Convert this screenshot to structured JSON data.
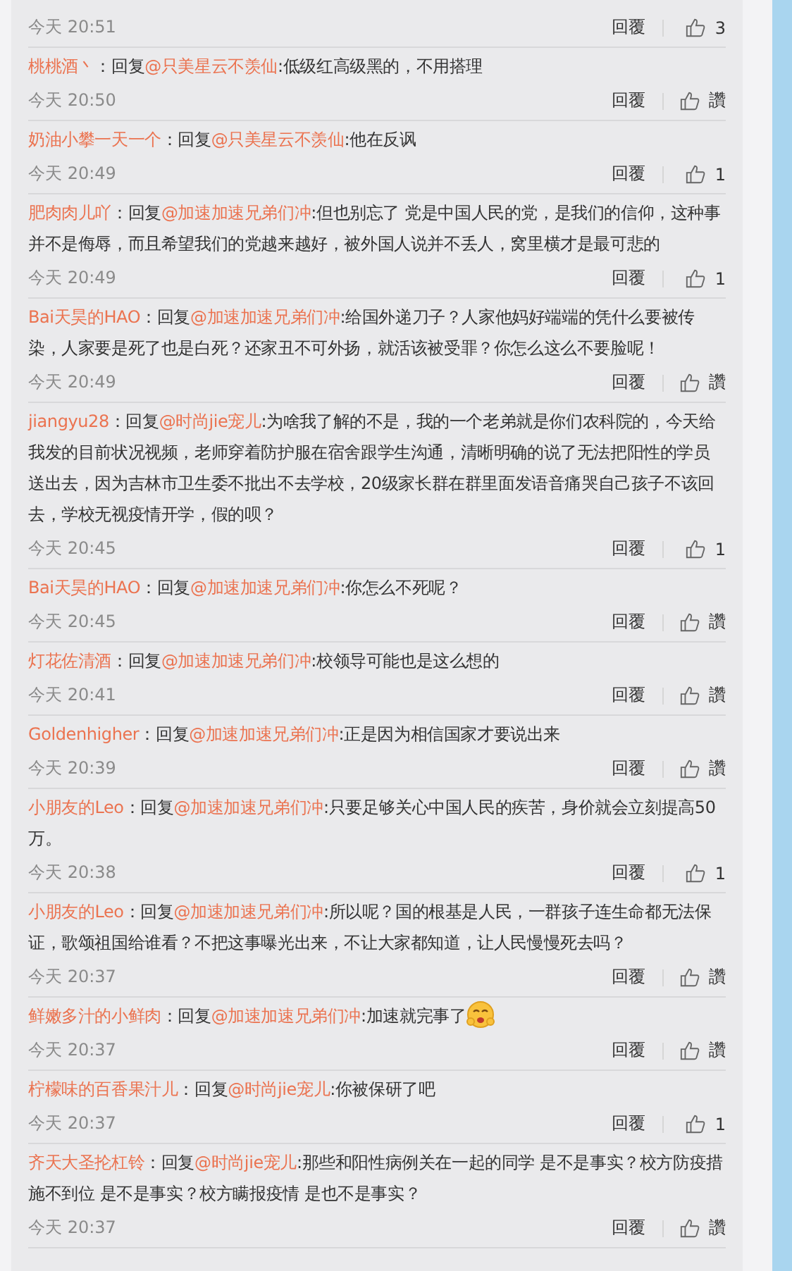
{
  "top_footer": {
    "time": "今天 20:51",
    "reply_button": "回覆",
    "likes": "3"
  },
  "comments": [
    {
      "user": "桃桃酒丶",
      "colon": "：",
      "reply_word": "回复",
      "mention": "@只美星云不羡仙",
      "text": ":低级红高级黑的，不用搭理",
      "emoji": false,
      "time": "今天 20:50",
      "reply_button": "回覆",
      "likes": "讚"
    },
    {
      "user": "奶油小攀一天一个",
      "colon": "：",
      "reply_word": "回复",
      "mention": "@只美星云不羡仙",
      "text": ":他在反讽",
      "emoji": false,
      "time": "今天 20:49",
      "reply_button": "回覆",
      "likes": "1"
    },
    {
      "user": "肥肉肉儿吖",
      "colon": "：",
      "reply_word": "回复",
      "mention": "@加速加速兄弟们冲",
      "text": ":但也别忘了 党是中国人民的党，是我们的信仰，这种事并不是侮辱，而且希望我们的党越来越好，被外国人说并不丢人，窝里横才是最可悲的",
      "emoji": false,
      "time": "今天 20:49",
      "reply_button": "回覆",
      "likes": "1"
    },
    {
      "user": "Bai天昊的HAO",
      "colon": "：",
      "reply_word": "回复",
      "mention": "@加速加速兄弟们冲",
      "text": ":给国外递刀子？人家他妈好端端的凭什么要被传染，人家要是死了也是白死？还家丑不可外扬，就活该被受罪？你怎么这么不要脸呢！",
      "emoji": false,
      "time": "今天 20:49",
      "reply_button": "回覆",
      "likes": "讚"
    },
    {
      "user": "jiangyu28",
      "colon": "：",
      "reply_word": "回复",
      "mention": "@时尚jie宠儿",
      "text": ":为啥我了解的不是，我的一个老弟就是你们农科院的，今天给我发的目前状况视频，老师穿着防护服在宿舍跟学生沟通，清晰明确的说了无法把阳性的学员送出去，因为吉林市卫生委不批出不去学校，20级家长群在群里面发语音痛哭自己孩子不该回去，学校无视疫情开学，假的呗？",
      "emoji": false,
      "time": "今天 20:45",
      "reply_button": "回覆",
      "likes": "1"
    },
    {
      "user": "Bai天昊的HAO",
      "colon": "：",
      "reply_word": "回复",
      "mention": "@加速加速兄弟们冲",
      "text": ":你怎么不死呢？",
      "emoji": false,
      "time": "今天 20:45",
      "reply_button": "回覆",
      "likes": "讚"
    },
    {
      "user": "灯花佐清酒",
      "colon": "：",
      "reply_word": "回复",
      "mention": "@加速加速兄弟们冲",
      "text": ":校领导可能也是这么想的",
      "emoji": false,
      "time": "今天 20:41",
      "reply_button": "回覆",
      "likes": "讚"
    },
    {
      "user": "Goldenhigher",
      "colon": "：",
      "reply_word": "回复",
      "mention": "@加速加速兄弟们冲",
      "text": ":正是因为相信国家才要说出来",
      "emoji": false,
      "time": "今天 20:39",
      "reply_button": "回覆",
      "likes": "讚"
    },
    {
      "user": "小朋友的Leo",
      "colon": "：",
      "reply_word": "回复",
      "mention": "@加速加速兄弟们冲",
      "text": ":只要足够关心中国人民的疾苦，身价就会立刻提高50万。",
      "emoji": false,
      "time": "今天 20:38",
      "reply_button": "回覆",
      "likes": "1"
    },
    {
      "user": "小朋友的Leo",
      "colon": "：",
      "reply_word": "回复",
      "mention": "@加速加速兄弟们冲",
      "text": ":所以呢？国的根基是人民，一群孩子连生命都无法保证，歌颂祖国给谁看？不把这事曝光出来，不让大家都知道，让人民慢慢死去吗？",
      "emoji": false,
      "time": "今天 20:37",
      "reply_button": "回覆",
      "likes": "讚"
    },
    {
      "user": "鲜嫩多汁的小鲜肉",
      "colon": "：",
      "reply_word": "回复",
      "mention": "@加速加速兄弟们冲",
      "text": ":加速就完事了",
      "emoji": true,
      "time": "今天 20:37",
      "reply_button": "回覆",
      "likes": "讚"
    },
    {
      "user": "柠檬味的百香果汁儿",
      "colon": "：",
      "reply_word": "回复",
      "mention": "@时尚jie宠儿",
      "text": ":你被保研了吧",
      "emoji": false,
      "time": "今天 20:37",
      "reply_button": "回覆",
      "likes": "1"
    },
    {
      "user": "齐天大圣抡杠铃",
      "colon": "：",
      "reply_word": "回复",
      "mention": "@时尚jie宠儿",
      "text": ":那些和阳性病例关在一起的同学 是不是事实？校方防疫措施不到位 是不是事实？校方瞒报疫情 是也不是事实？",
      "emoji": false,
      "time": "今天 20:37",
      "reply_button": "回覆",
      "likes": "讚"
    }
  ]
}
